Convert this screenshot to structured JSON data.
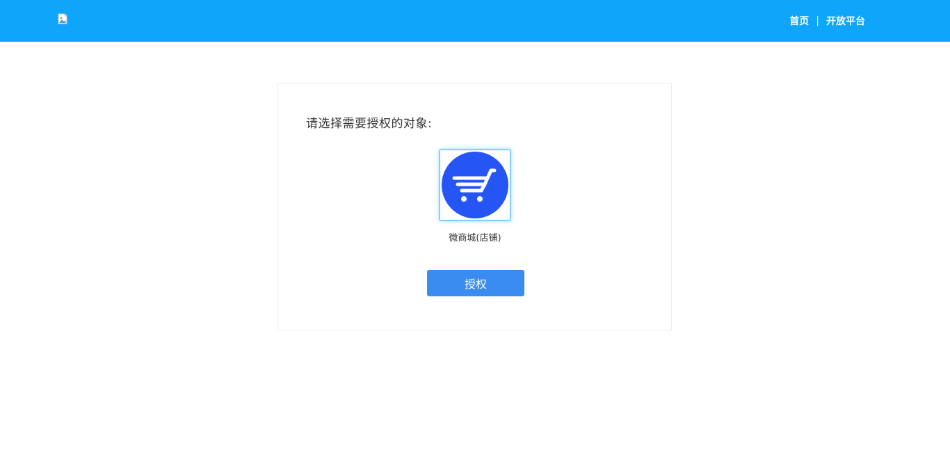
{
  "header": {
    "logo_icon": "broken-image-icon",
    "nav": {
      "home_label": "首页",
      "separator": "|",
      "open_platform_label": "开放平台"
    },
    "background_color": "#0ea5fa"
  },
  "card": {
    "title": "请选择需要授权的对象:",
    "options": [
      {
        "icon": "shopping-cart-icon",
        "icon_color": "#2556f5",
        "label": "微商城(店铺)",
        "selected": true
      }
    ],
    "authorize_button_label": "授权",
    "button_color": "#3b8cf0"
  }
}
